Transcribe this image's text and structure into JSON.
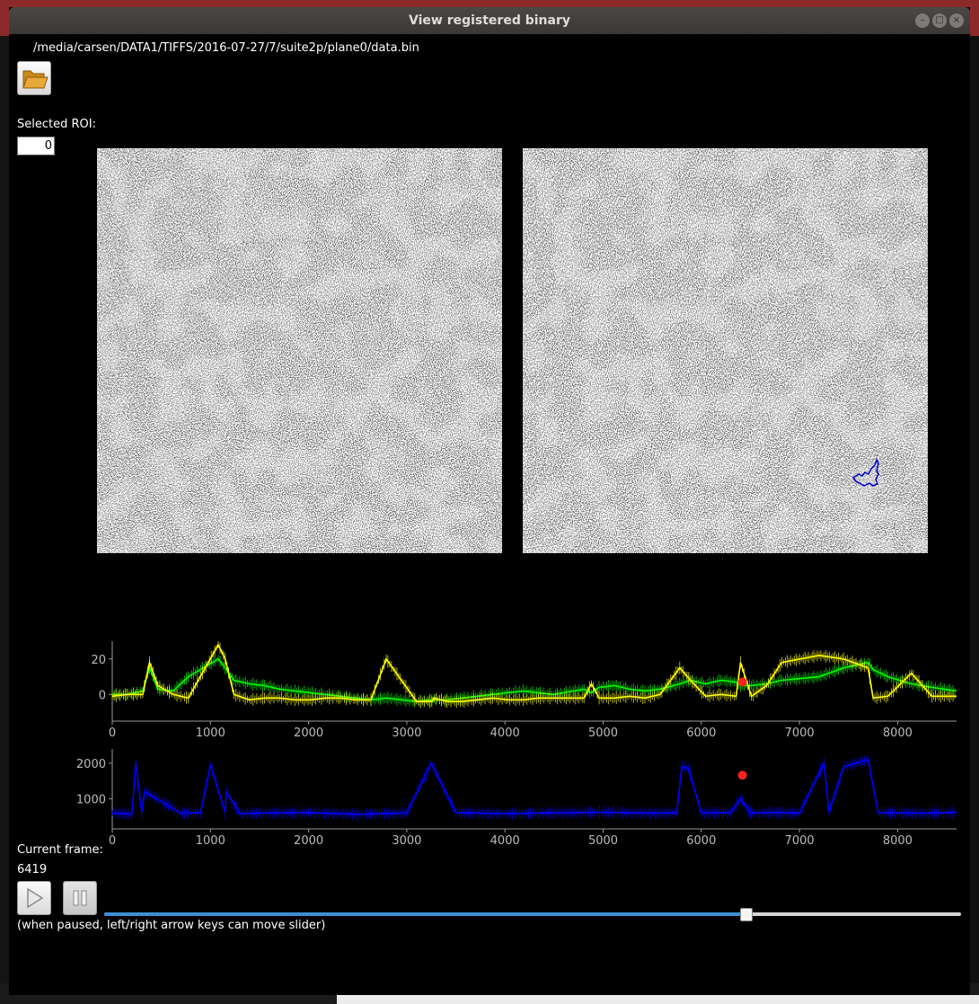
{
  "window": {
    "title": "View registered binary",
    "file_path": "/media/carsen/DATA1/TIFFS/2016-07-27/7/suite2p/plane0/data.bin"
  },
  "icons": {
    "open": "folder-open-icon",
    "play": "play-icon",
    "pause": "pause-icon",
    "minimize": "minimize-icon",
    "maximize": "maximize-icon",
    "close": "close-icon"
  },
  "roi": {
    "label": "Selected ROI:",
    "value": "0"
  },
  "colors": {
    "fluorescence_trace": "#00ff00",
    "neuropil_trace": "#ffff00",
    "roi_trace": "#0000ff",
    "frame_marker": "#ff2020",
    "roi_outline": "#0000cc",
    "slider_fill": "#3d8ed6"
  },
  "chart_data": [
    {
      "type": "line",
      "series": [
        {
          "values": [
            0,
            0,
            2,
            15,
            3,
            2,
            10,
            20,
            15,
            8,
            6,
            5,
            3,
            2,
            1,
            0,
            -1,
            -2,
            -3,
            -2,
            -3,
            -4,
            -3,
            -3,
            -2,
            -1,
            0,
            1,
            2,
            1,
            0,
            1,
            3,
            4,
            5,
            3,
            2,
            3,
            6,
            8,
            5,
            6,
            8,
            7,
            5,
            6,
            8,
            10,
            15,
            18,
            14,
            10,
            6,
            4,
            2
          ]
        },
        {
          "values": [
            -1,
            0,
            0,
            18,
            5,
            0,
            -2,
            28,
            20,
            0,
            -3,
            -2,
            -2,
            -3,
            -3,
            -2,
            -2,
            -3,
            -3,
            20,
            -2,
            -4,
            -4,
            -4,
            -4,
            -3,
            -2,
            -3,
            -3,
            -2,
            -2,
            6,
            -2,
            -2,
            -2,
            -1,
            -2,
            0,
            15,
            8,
            18,
            -1,
            0,
            -1,
            -1,
            5,
            18,
            22,
            20,
            15,
            -2,
            -1,
            12,
            -1,
            -1
          ]
        }
      ],
      "x": [
        0,
        155,
        310,
        380,
        465,
        620,
        775,
        1080,
        1150,
        1240,
        1395,
        1550,
        1705,
        1860,
        2015,
        2170,
        2325,
        2480,
        2635,
        2790,
        3280,
        3100,
        3255,
        3410,
        3565,
        3720,
        3875,
        4030,
        4185,
        4340,
        4495,
        4880,
        4805,
        4960,
        5115,
        5270,
        5425,
        5580,
        5780,
        5890,
        6400,
        6045,
        6200,
        6355,
        6510,
        6665,
        6820,
        7200,
        7450,
        7700,
        7750,
        7900,
        8140,
        8350,
        8600
      ],
      "xlim": [
        0,
        8600
      ],
      "ylim": [
        -15,
        30
      ],
      "x_ticks": [
        0,
        1000,
        2000,
        3000,
        4000,
        5000,
        6000,
        7000,
        8000
      ],
      "y_ticks": [
        0,
        20
      ],
      "marker": {
        "x": 6419,
        "y": 7
      }
    },
    {
      "type": "line",
      "series": [
        {
          "values": [
            600,
            560,
            2000,
            620,
            1200,
            590,
            610,
            1950,
            620,
            1200,
            580,
            600,
            610,
            560,
            600,
            2000,
            610,
            580,
            600,
            620,
            590,
            600,
            610,
            1900,
            1850,
            600,
            610,
            1000,
            600,
            610,
            590,
            2000,
            620,
            1900,
            2100,
            610,
            600,
            590,
            620
          ]
        }
      ],
      "x": [
        0,
        200,
        240,
        300,
        330,
        700,
        900,
        1000,
        1150,
        1160,
        1300,
        1600,
        2000,
        2500,
        3000,
        3250,
        3500,
        4000,
        4500,
        5000,
        5500,
        5700,
        5750,
        5800,
        5870,
        6000,
        6300,
        6400,
        6500,
        6800,
        7000,
        7250,
        7300,
        7450,
        7700,
        7800,
        8000,
        8300,
        8600
      ],
      "xlim": [
        0,
        8600
      ],
      "ylim": [
        150,
        2400
      ],
      "x_ticks": [
        0,
        1000,
        2000,
        3000,
        4000,
        5000,
        6000,
        7000,
        8000
      ],
      "y_ticks": [
        1000,
        2000
      ],
      "marker": {
        "x": 6419,
        "y": 1660
      }
    }
  ],
  "playback": {
    "current_frame_label": "Current frame:",
    "current_frame": "6419",
    "frame_fraction": 0.748,
    "hint": "(when paused, left/right arrow keys can move slider)"
  }
}
